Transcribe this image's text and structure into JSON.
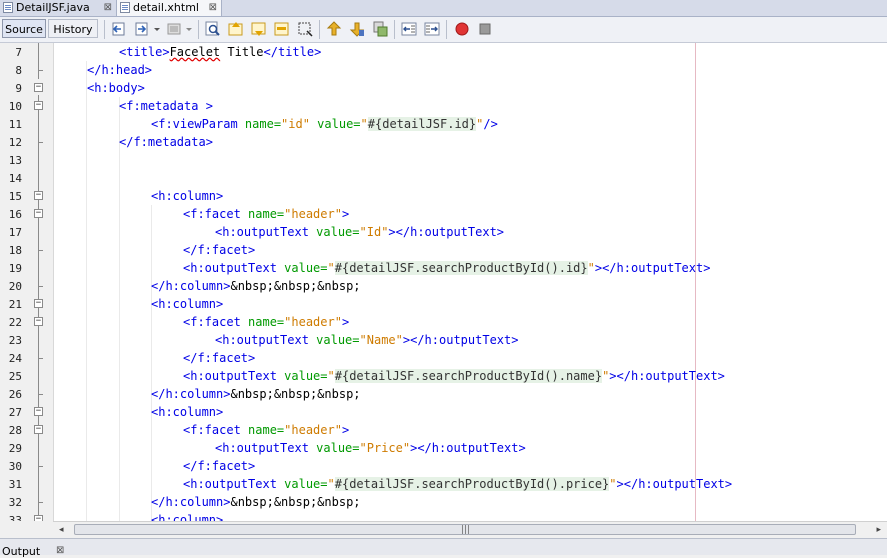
{
  "tabs": [
    {
      "label": "DetailJSF.java",
      "close": "⊠"
    },
    {
      "label": "detail.xhtml",
      "close": "⊠"
    }
  ],
  "toolbar": {
    "source_label": "Source",
    "history_label": "History"
  },
  "editor": {
    "lines": [
      {
        "n": "7"
      },
      {
        "n": "8"
      },
      {
        "n": "9"
      },
      {
        "n": "10"
      },
      {
        "n": "11"
      },
      {
        "n": "12"
      },
      {
        "n": "13"
      },
      {
        "n": "14"
      },
      {
        "n": "15"
      },
      {
        "n": "16"
      },
      {
        "n": "17"
      },
      {
        "n": "18"
      },
      {
        "n": "19"
      },
      {
        "n": "20"
      },
      {
        "n": "21"
      },
      {
        "n": "22"
      },
      {
        "n": "23"
      },
      {
        "n": "24"
      },
      {
        "n": "25"
      },
      {
        "n": "26"
      },
      {
        "n": "27"
      },
      {
        "n": "28"
      },
      {
        "n": "29"
      },
      {
        "n": "30"
      },
      {
        "n": "31"
      },
      {
        "n": "32"
      },
      {
        "n": "33"
      }
    ],
    "code": {
      "l7a": "<title>",
      "l7b": "Facelet",
      "l7c": " Title",
      "l7d": "</title>",
      "l8": "</h:head>",
      "l9": "<h:body>",
      "l10": "<f:metadata >",
      "l11a": "<f:viewParam ",
      "l11b": "name=",
      "l11c": "\"id\"",
      "l11d": " value=",
      "l11e": "\"",
      "l11f": "#{detailJSF.id}",
      "l11g": "\"",
      "l11h": "/>",
      "l12": "</f:metadata>",
      "l15": "<h:column>",
      "l16a": "<f:facet ",
      "l16b": "name=",
      "l16c": "\"header\"",
      "l16d": ">",
      "l17a": "<h:outputText ",
      "l17b": "value=",
      "l17c": "\"Id\"",
      "l17d": "></h:outputText>",
      "l18": "</f:facet>",
      "l19a": "<h:outputText ",
      "l19b": "value=",
      "l19c": "\"",
      "l19d": "#{detailJSF.searchProductById().id}",
      "l19e": "\"",
      "l19f": "></h:outputText>",
      "l20a": "</h:column>",
      "l20b": "&nbsp;&nbsp;&nbsp;",
      "l21": "<h:column>",
      "l22a": "<f:facet ",
      "l22b": "name=",
      "l22c": "\"header\"",
      "l22d": ">",
      "l23a": "<h:outputText ",
      "l23b": "value=",
      "l23c": "\"Name\"",
      "l23d": "></h:outputText>",
      "l24": "</f:facet>",
      "l25a": "<h:outputText ",
      "l25b": "value=",
      "l25c": "\"",
      "l25d": "#{detailJSF.searchProductById().name}",
      "l25e": "\"",
      "l25f": "></h:outputText>",
      "l26a": "</h:column>",
      "l26b": "&nbsp;&nbsp;&nbsp;",
      "l27": "<h:column>",
      "l28a": "<f:facet ",
      "l28b": "name=",
      "l28c": "\"header\"",
      "l28d": ">",
      "l29a": "<h:outputText ",
      "l29b": "value=",
      "l29c": "\"Price\"",
      "l29d": "></h:outputText>",
      "l30": "</f:facet>",
      "l31a": "<h:outputText ",
      "l31b": "value=",
      "l31c": "\"",
      "l31d": "#{detailJSF.searchProductById().price}",
      "l31e": "\"",
      "l31f": "></h:outputText>",
      "l32a": "</h:column>",
      "l32b": "&nbsp;&nbsp;&nbsp;",
      "l33": "<h:column>"
    }
  },
  "scrollbar": {
    "grip": "|||",
    "left_arrow": "◂",
    "right_arrow": "▸"
  },
  "output": {
    "label": "Output",
    "close": "⊠"
  },
  "colors": {
    "tag": "#0000e6",
    "attr": "#009900",
    "value": "#ce7b00",
    "el_background": "#e6f2e6",
    "margin_line": "#e6b9c3"
  },
  "icons": [
    "back-icon",
    "forward-dropdown-icon",
    "history-dropdown-icon",
    "find-icon",
    "find-previous-icon",
    "find-next-icon",
    "toggle-highlight-icon",
    "toggle-rect-selection-icon",
    "prev-bookmark-icon",
    "next-bookmark-icon",
    "toggle-bookmark-icon",
    "shift-left-icon",
    "shift-right-icon",
    "start-macro-icon",
    "stop-macro-icon"
  ]
}
